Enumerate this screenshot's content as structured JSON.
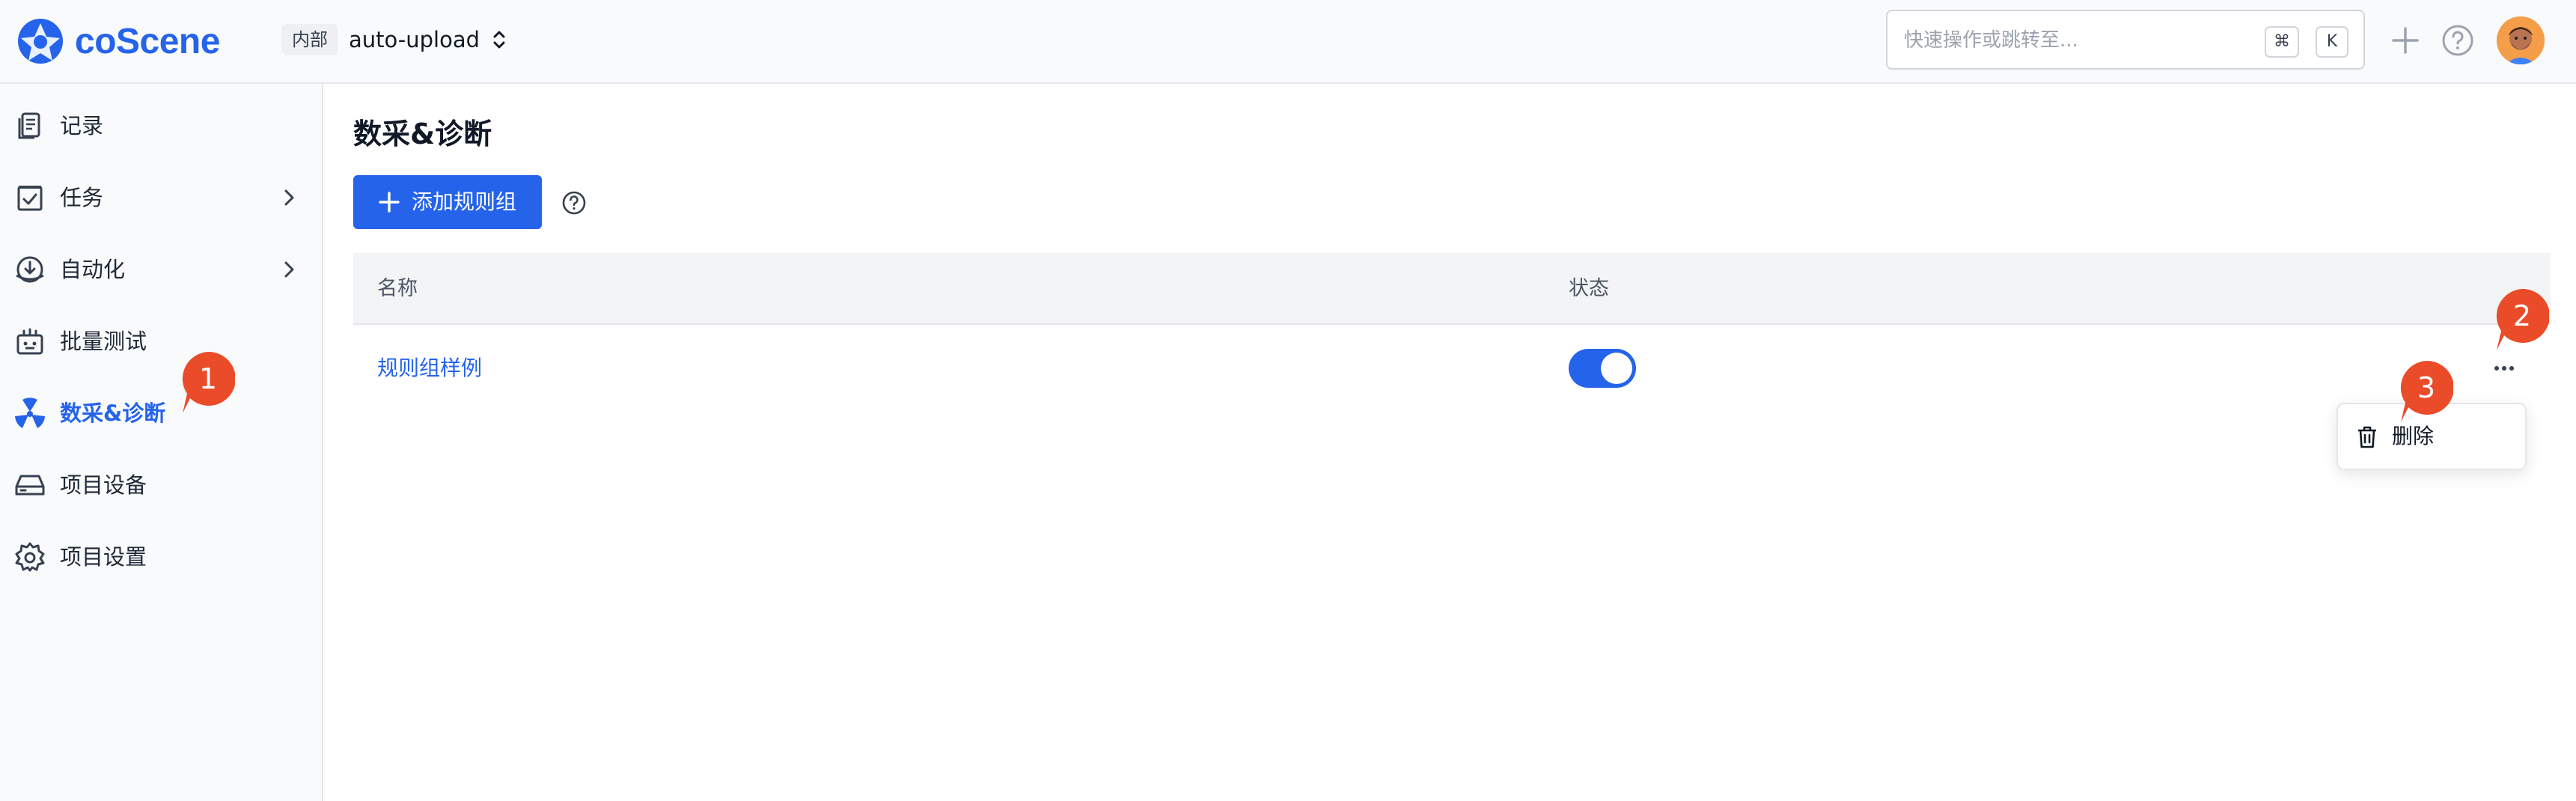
{
  "header": {
    "logo_text": "coScene",
    "org_badge": "内部",
    "project_name": "auto-upload",
    "search_placeholder": "快速操作或跳转至...",
    "shortcut_cmd": "⌘",
    "shortcut_key": "K"
  },
  "sidebar": {
    "items": [
      {
        "label": "记录",
        "icon": "records-icon",
        "has_chevron": false,
        "active": false
      },
      {
        "label": "任务",
        "icon": "tasks-icon",
        "has_chevron": true,
        "active": false
      },
      {
        "label": "自动化",
        "icon": "automation-icon",
        "has_chevron": true,
        "active": false
      },
      {
        "label": "批量测试",
        "icon": "batch-test-icon",
        "has_chevron": false,
        "active": false
      },
      {
        "label": "数采&诊断",
        "icon": "diagnosis-icon",
        "has_chevron": false,
        "active": true
      },
      {
        "label": "项目设备",
        "icon": "device-icon",
        "has_chevron": false,
        "active": false
      },
      {
        "label": "项目设置",
        "icon": "settings-icon",
        "has_chevron": false,
        "active": false
      }
    ]
  },
  "main": {
    "title": "数采&诊断",
    "add_button_label": "添加规则组",
    "table": {
      "columns": [
        "名称",
        "状态"
      ],
      "rows": [
        {
          "name": "规则组样例",
          "enabled": true
        }
      ]
    },
    "row_menu": {
      "items": [
        {
          "label": "删除",
          "icon": "trash-icon"
        }
      ]
    }
  },
  "markers": [
    {
      "number": "1"
    },
    {
      "number": "2"
    },
    {
      "number": "3"
    }
  ],
  "colors": {
    "accent": "#2563eb",
    "marker": "#ea4c2a",
    "sidebar_bg": "#f9fafb",
    "table_header_bg": "#f3f4f6"
  }
}
